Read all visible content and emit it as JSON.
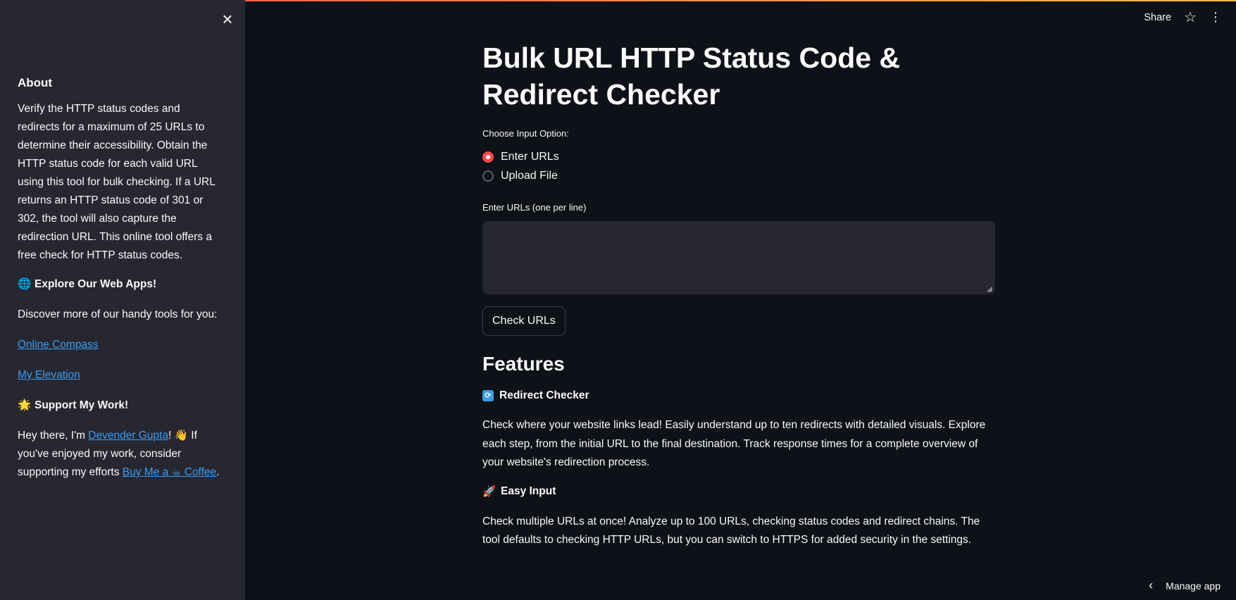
{
  "sidebar": {
    "about_heading": "About",
    "about_text": "Verify the HTTP status codes and redirects for a maximum of 25 URLs to determine their accessibility. Obtain the HTTP status code for each valid URL using this tool for bulk checking. If a URL returns an HTTP status code of 301 or 302, the tool will also capture the redirection URL. This online tool offers a free check for HTTP status codes.",
    "explore_heading": "Explore Our Web Apps!",
    "explore_text": "Discover more of our handy tools for you:",
    "link1": "Online Compass",
    "link2": "My Elevation",
    "support_heading": "Support My Work!",
    "support_text_1": "Hey there, I'm ",
    "author_link": "Devender Gupta",
    "support_text_2": "! 👋 If you've enjoyed my work, consider supporting my efforts ",
    "coffee_link": "Buy Me a ☕ Coffee",
    "support_text_3": "."
  },
  "toolbar": {
    "share_label": "Share"
  },
  "main": {
    "title": "Bulk URL HTTP Status Code & Redirect Checker",
    "input_option_label": "Choose Input Option:",
    "radio_options": [
      "Enter URLs",
      "Upload File"
    ],
    "selected_option": "Enter URLs",
    "textarea_label": "Enter URLs (one per line)",
    "textarea_value": "",
    "check_button": "Check URLs",
    "features_heading": "Features",
    "feature1_title": "Redirect Checker",
    "feature1_text": "Check where your website links lead! Easily understand up to ten redirects with detailed visuals. Explore each step, from the initial URL to the final destination. Track response times for a complete overview of your website's redirection process.",
    "feature2_title": "Easy Input",
    "feature2_text": "Check multiple URLs at once! Analyze up to 100 URLs, checking status codes and redirect chains. The tool defaults to checking HTTP URLs, but you can switch to HTTPS for added security in the settings."
  },
  "footer": {
    "manage_label": "Manage app"
  },
  "colors": {
    "accent": "#ff4b4b",
    "link": "#3d9df3",
    "sidebar_bg": "#262730",
    "main_bg": "#0e1117"
  }
}
